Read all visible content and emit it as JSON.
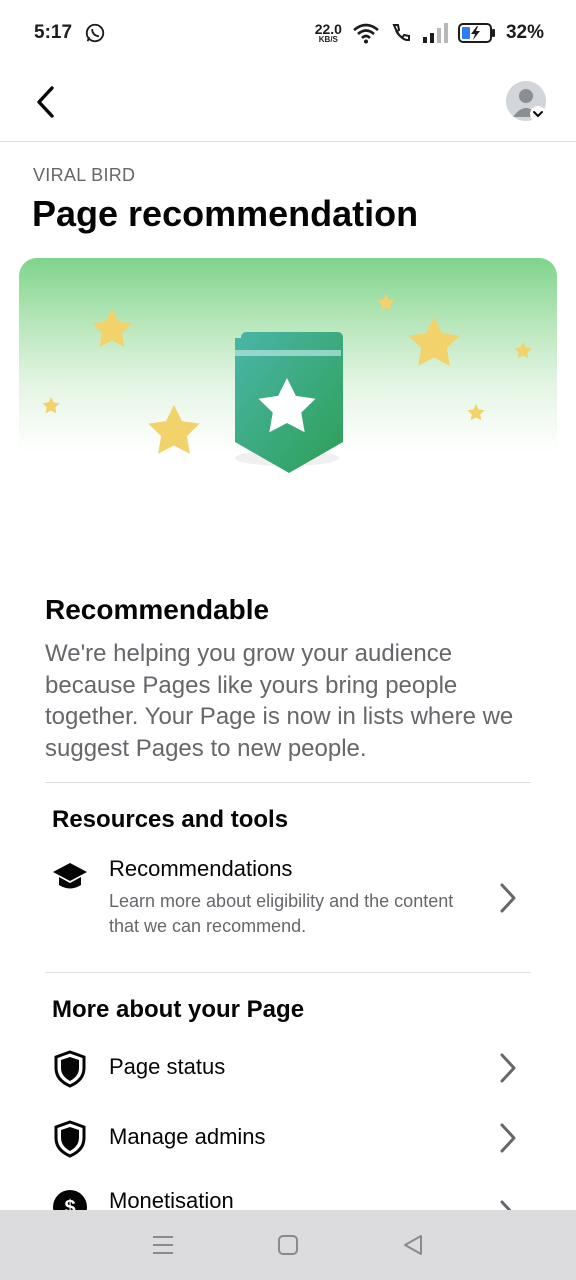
{
  "status_bar": {
    "time": "5:17",
    "net_speed_value": "22.0",
    "net_speed_unit": "KB/S",
    "battery_percent": "32%"
  },
  "header": {
    "page_name": "VIRAL BIRD",
    "title": "Page recommendation"
  },
  "recommendable": {
    "title": "Recommendable",
    "description": "We're helping you grow your audience because Pages like yours bring people together. Your Page is now in lists where we suggest Pages to new people."
  },
  "resources": {
    "heading": "Resources and tools",
    "items": [
      {
        "title": "Recommendations",
        "subtitle": "Learn more about eligibility and the content that we can recommend.",
        "icon": "graduation-cap-icon"
      }
    ]
  },
  "more_about": {
    "heading": "More about your Page",
    "items": [
      {
        "title": "Page status",
        "icon": "shield-icon"
      },
      {
        "title": "Manage admins",
        "icon": "shield-icon"
      },
      {
        "title": "Monetisation",
        "icon": "dollar-icon"
      }
    ]
  },
  "colors": {
    "hero_green": "#7fd48b",
    "badge_teal": "#3fb0a0",
    "badge_green": "#2fa05a",
    "star_yellow": "#f2d26b",
    "nav_bar": "#dcdcde"
  }
}
